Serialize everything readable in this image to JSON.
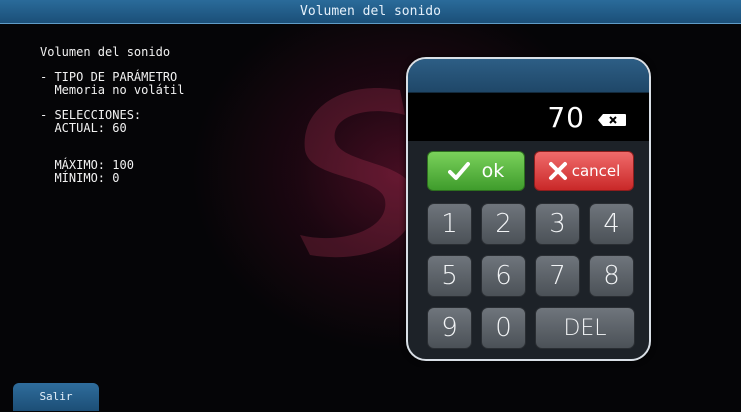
{
  "window": {
    "title": "Volumen del sonido"
  },
  "info": {
    "heading": "Volumen del sonido",
    "param_type_label": "- TIPO DE PARÁMETRO",
    "param_type_value": "  Memoria no volátil",
    "selections_label": "- SELECCIONES:",
    "current": "  ACTUAL: 60",
    "max": "  MÁXIMO: 100",
    "min": "  MÍNIMO: 0"
  },
  "keypad": {
    "display_value": "70",
    "ok_label": "ok",
    "cancel_label": "cancel",
    "keys": [
      "1",
      "2",
      "3",
      "4",
      "5",
      "6",
      "7",
      "8",
      "9",
      "0"
    ],
    "del_label": "DEL"
  },
  "footer": {
    "exit_label": "Salir"
  },
  "colors": {
    "titlebar": "#1b4f78",
    "ok": "#4caf35",
    "cancel": "#d93434",
    "key": "#5a6067"
  },
  "icons": [
    "backspace-icon",
    "checkmark-icon",
    "x-icon"
  ]
}
